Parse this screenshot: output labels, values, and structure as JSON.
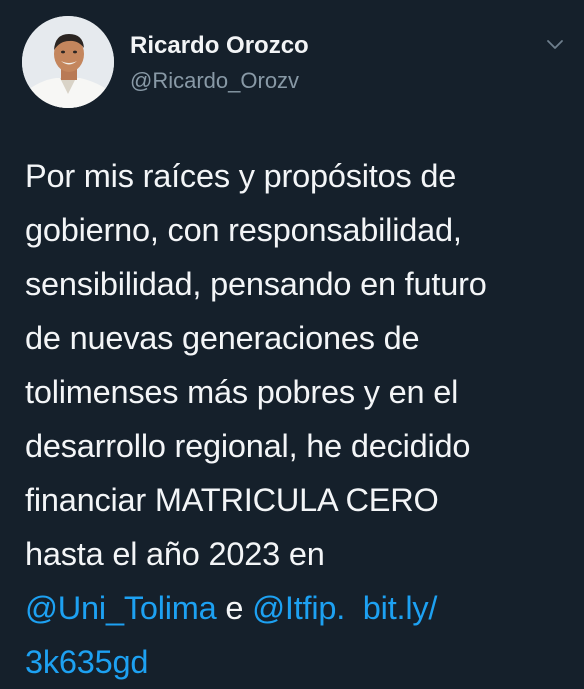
{
  "author": {
    "display_name": "Ricardo Orozco",
    "handle": "@Ricardo_Orozv",
    "avatar_icon": "profile-photo"
  },
  "menu": {
    "icon": "chevron-down-icon"
  },
  "tweet": {
    "lines": [
      "Por mis raíces y propósitos de",
      "gobierno, con responsabilidad,",
      "sensibilidad, pensando en futuro",
      "de nuevas generaciones de",
      "tolimenses más pobres y en el",
      "desarrollo regional, he decidido",
      "financiar MATRICULA CERO",
      "hasta el año 2023 en"
    ],
    "mention_1": "@Uni_Tolima",
    "connector": "e",
    "mention_2": "@Itfip.",
    "link_part_1": "bit.ly/",
    "link_part_2": "3k635gd"
  },
  "colors": {
    "background": "#15202b",
    "text": "#f3f5f7",
    "secondary_text": "#8899a6",
    "link": "#1da1f2"
  }
}
